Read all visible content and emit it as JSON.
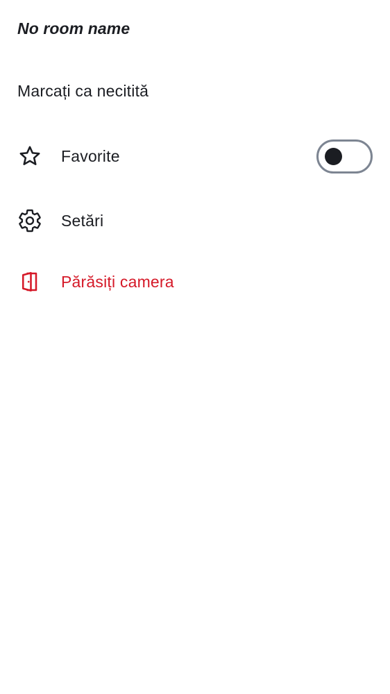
{
  "header": {
    "room_name": "No room name"
  },
  "menu": {
    "mark_unread": {
      "label": "Marcați ca necitită"
    },
    "favourite": {
      "label": "Favorite",
      "icon": "star-outline-icon",
      "toggle_on": false
    },
    "settings": {
      "label": "Setări",
      "icon": "gear-icon"
    },
    "leave": {
      "label": "Părăsiți camera",
      "icon": "leave-door-icon",
      "color": "#d51928"
    }
  },
  "colors": {
    "text": "#1b1d22",
    "danger": "#d51928",
    "toggle_border": "#7d8592",
    "background": "#ffffff"
  }
}
